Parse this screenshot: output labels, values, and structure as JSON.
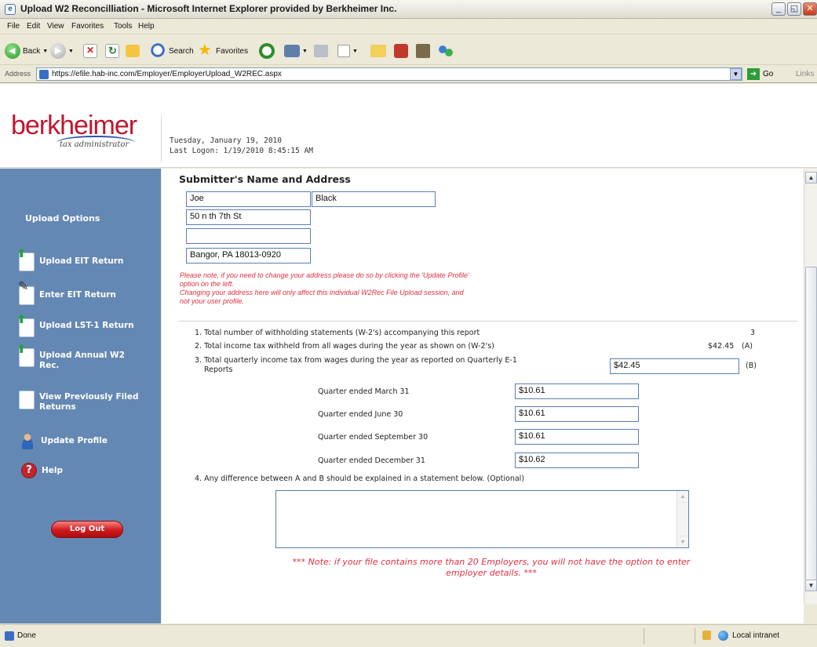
{
  "window": {
    "title": "Upload W2 Reconcilliation - Microsoft Internet Explorer provided by Berkheimer Inc.",
    "minimize": "_",
    "restore": "◱",
    "close": "✕"
  },
  "menu": [
    "File",
    "Edit",
    "View",
    "Favorites",
    "Tools",
    "Help"
  ],
  "toolbar": {
    "back_label": "Back",
    "search_label": "Search",
    "favorites_label": "Favorites"
  },
  "address": {
    "label": "Address",
    "url": "https://efile.hab-inc.com/Employer/EmployerUpload_W2REC.aspx",
    "go_label": "Go",
    "links_label": "Links"
  },
  "header": {
    "logo_word": "berkheimer",
    "logo_sub": "tax administrator",
    "date": "Tuesday, January 19, 2010",
    "last_logon": "Last Logon: 1/19/2010 8:45:15 AM"
  },
  "sidebar": {
    "heading": "Upload Options",
    "items": [
      {
        "label": "Upload EIT Return",
        "icon": "upload-document-icon"
      },
      {
        "label": "Enter EIT Return",
        "icon": "edit-document-icon"
      },
      {
        "label": "Upload LST-1 Return",
        "icon": "upload-document-icon"
      },
      {
        "label": "Upload Annual W2 Rec.",
        "icon": "upload-document-icon"
      },
      {
        "label": "View Previously Filed Returns",
        "icon": "document-icon"
      },
      {
        "label": "Update Profile",
        "icon": "user-icon"
      },
      {
        "label": "Help",
        "icon": "help-icon"
      }
    ],
    "logout_label": "Log Out"
  },
  "form": {
    "section_title": "Submitter's Name and Address",
    "first_name": "Joe",
    "last_name": "Black",
    "address1": "50 n th 7th St",
    "address2": "",
    "city_state_zip": "Bangor, PA 18013-0920",
    "note_line1": "Please note, if you need to change your address please do so by clicking the 'Update Profile'",
    "note_line2": "option on the left.",
    "note_line3": "Changing your address here will only affect this individual W2Rec File Upload session, and",
    "note_line4": "not your user profile.",
    "line1_text": "1. Total number of withholding statements (W-2's) accompanying this report",
    "line1_value": "3",
    "line2_text": "2. Total income tax withheld from all wages during the year as shown on (W-2's)",
    "line2_value": "$42.45",
    "line2_code": "(A)",
    "line3_text_a": "3. Total quarterly income tax from wages during the year as reported on Quarterly E-1",
    "line3_text_b": "Reports",
    "line3_value": "$42.45",
    "line3_code": "(B)",
    "quarters": [
      {
        "label": "Quarter ended March 31",
        "value": "$10.61"
      },
      {
        "label": "Quarter ended June 30",
        "value": "$10.61"
      },
      {
        "label": "Quarter ended September 30",
        "value": "$10.61"
      },
      {
        "label": "Quarter ended December 31",
        "value": "$10.62"
      }
    ],
    "line4_text": "4. Any difference between A and B should be explained in a statement below. (Optional)",
    "statement": "",
    "bottom_note_line1": "*** Note: if your file contains more than 20 Employers, you will not have the option to enter",
    "bottom_note_line2": "employer details. ***"
  },
  "status": {
    "text": "Done",
    "zone": "Local intranet"
  }
}
